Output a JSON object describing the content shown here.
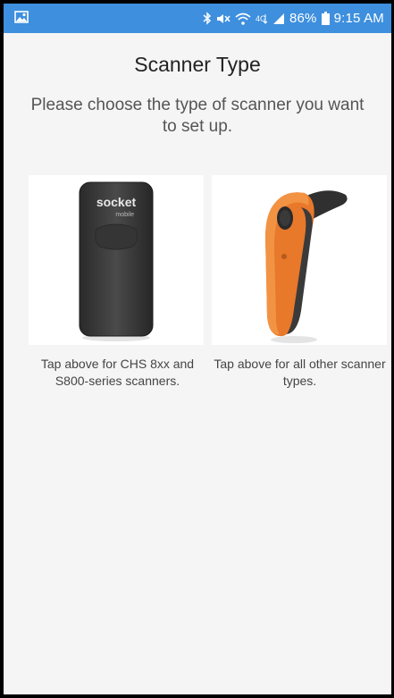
{
  "status_bar": {
    "battery_percent": "86%",
    "time": "9:15 AM",
    "icons": [
      "image-notification-icon",
      "bluetooth-icon",
      "mute-icon",
      "wifi-icon",
      "lte-icon",
      "signal-icon",
      "battery-icon"
    ],
    "background_color": "#3e8fde"
  },
  "page": {
    "title": "Scanner Type",
    "subtitle": "Please choose the type of scanner you want to set up."
  },
  "options": [
    {
      "brand_text": "socket",
      "brand_subtext": "mobile",
      "caption": "Tap above for CHS 8xx and S800-series scanners."
    },
    {
      "caption": "Tap above for all other scanner types."
    }
  ]
}
